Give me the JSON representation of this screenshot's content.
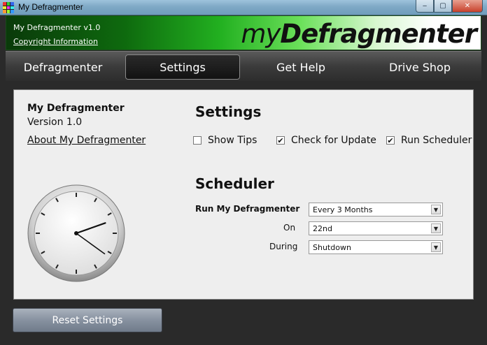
{
  "window": {
    "title": "My Defragmenter",
    "controls": {
      "minimize": "‒",
      "maximize": "▢",
      "close": "✕"
    }
  },
  "header": {
    "version_text": "My Defragmenter v1.0",
    "copyright_link": "Copyright Information",
    "logo_my": "my",
    "logo_brand": "Defragmenter"
  },
  "nav": {
    "tabs": [
      {
        "label": "Defragmenter",
        "active": false
      },
      {
        "label": "Settings",
        "active": true
      },
      {
        "label": "Get Help",
        "active": false
      },
      {
        "label": "Drive Shop",
        "active": false
      }
    ]
  },
  "about": {
    "app_name": "My Defragmenter",
    "version": "Version 1.0",
    "about_link": "About My Defragmenter"
  },
  "settings": {
    "heading": "Settings",
    "options": [
      {
        "label": "Show Tips",
        "checked": false
      },
      {
        "label": "Check for Update",
        "checked": true
      },
      {
        "label": "Run Scheduler",
        "checked": true
      }
    ]
  },
  "scheduler": {
    "heading": "Scheduler",
    "run_label": "Run My Defragmenter",
    "run_value": "Every 3 Months",
    "on_label": "On",
    "on_value": "22nd",
    "during_label": "During",
    "during_value": "Shutdown"
  },
  "clock": {
    "hour": 2,
    "minute": 21
  },
  "actions": {
    "reset_label": "Reset Settings"
  },
  "icons": {
    "check": "✔",
    "dropdown": "▼"
  },
  "colors": {
    "accent_green": "#22b020",
    "panel_bg": "#eeeeee",
    "nav_bg": "#3b3b3b"
  }
}
